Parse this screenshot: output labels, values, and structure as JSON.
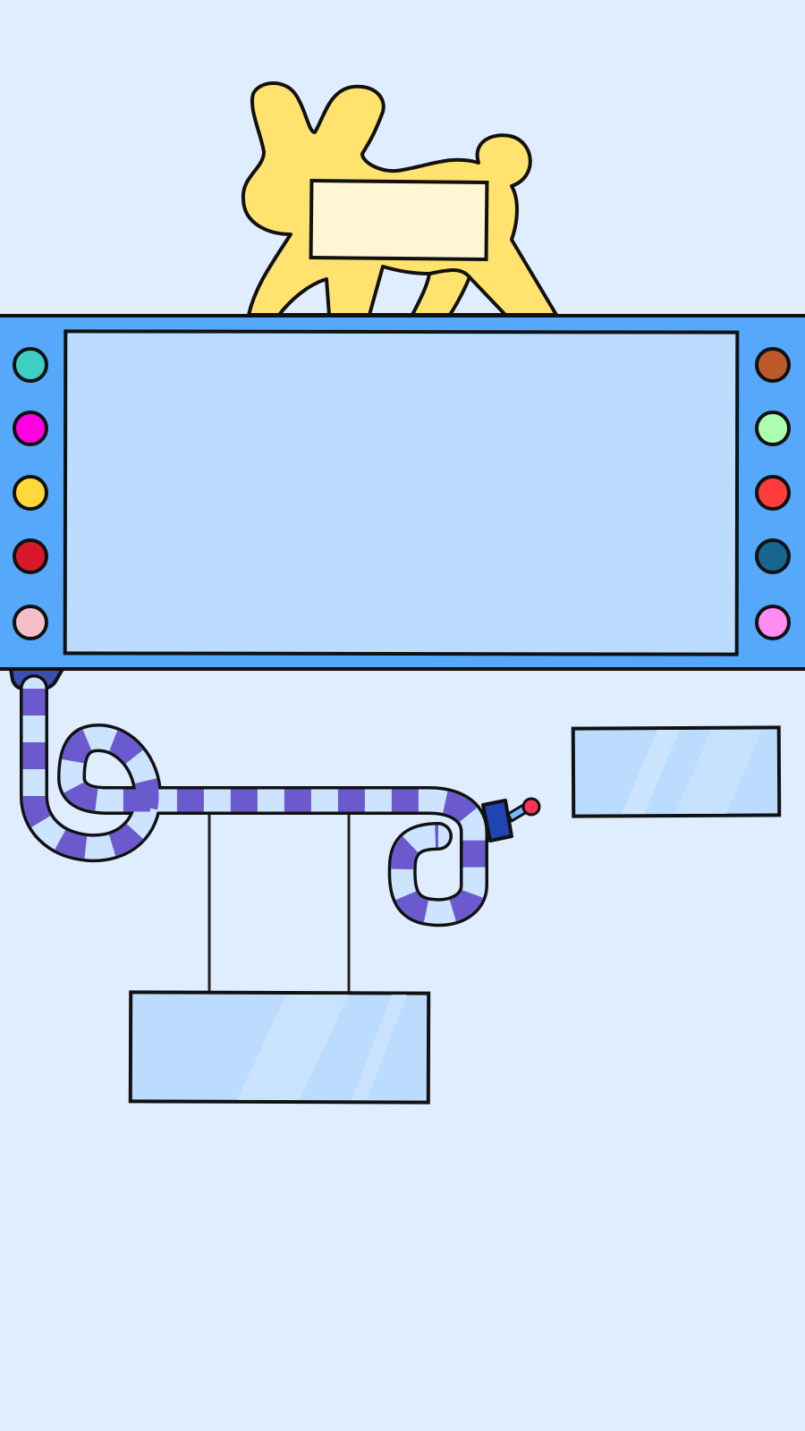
{
  "screen": {
    "background_color": "#e0edff",
    "mascot": {
      "icon": "yellow-dog-icon",
      "color": "#ffe36e",
      "label_color": "#fff6d4"
    },
    "board": {
      "frame_color": "#55a8fa",
      "screen_color": "#bbdcff",
      "left_buttons": [
        {
          "name": "teal",
          "color": "#3dcfc4"
        },
        {
          "name": "magenta",
          "color": "#ff00e0"
        },
        {
          "name": "yellow",
          "color": "#ffd93a"
        },
        {
          "name": "crimson",
          "color": "#d9172a"
        },
        {
          "name": "pink",
          "color": "#f5bfca"
        }
      ],
      "right_buttons": [
        {
          "name": "brown",
          "color": "#bd5a2b"
        },
        {
          "name": "mint",
          "color": "#aaffb0"
        },
        {
          "name": "red",
          "color": "#ff3b3b"
        },
        {
          "name": "dark-teal",
          "color": "#176690"
        },
        {
          "name": "light-magenta",
          "color": "#ff8cf0"
        }
      ]
    },
    "hose": {
      "icon": "striped-hose-icon",
      "stripe_color": "#6a5acd",
      "base_color": "#cce4ff",
      "nozzle_color": "#1f45b5",
      "nozzle_tip_color": "#ff3355"
    },
    "panels": [
      {
        "name": "right-glass-panel",
        "color": "#bbdcff"
      },
      {
        "name": "hanging-glass-panel",
        "color": "#bbdcff"
      }
    ]
  }
}
